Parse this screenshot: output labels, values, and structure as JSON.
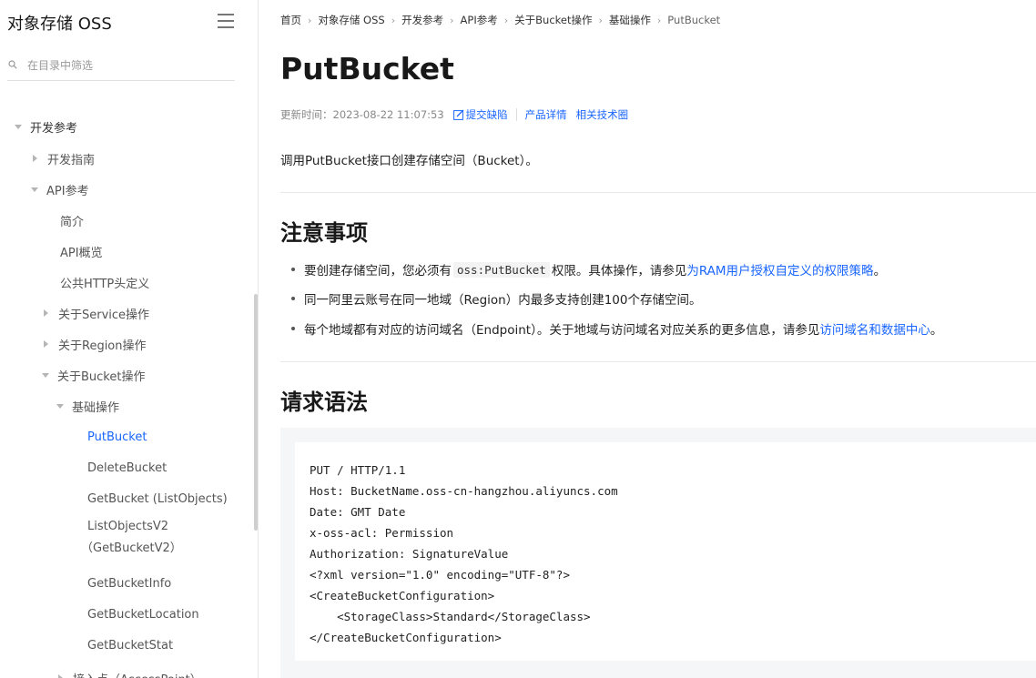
{
  "sidebar": {
    "title": "对象存储 OSS",
    "filter_placeholder": "在目录中筛选",
    "items": [
      {
        "label": "开发参考",
        "level": 1,
        "expanded": true
      },
      {
        "label": "开发指南",
        "level": 2,
        "expanded": false
      },
      {
        "label": "API参考",
        "level": 2,
        "expanded": true
      },
      {
        "label": "简介",
        "level": 3
      },
      {
        "label": "API概览",
        "level": 3
      },
      {
        "label": "公共HTTP头定义",
        "level": 3
      },
      {
        "label": "关于Service操作",
        "level": 3,
        "expanded": false
      },
      {
        "label": "关于Region操作",
        "level": 3,
        "expanded": false
      },
      {
        "label": "关于Bucket操作",
        "level": 3,
        "expanded": true
      },
      {
        "label": "基础操作",
        "level": 4,
        "expanded": true
      },
      {
        "label": "PutBucket",
        "level": 5,
        "active": true
      },
      {
        "label": "DeleteBucket",
        "level": 5
      },
      {
        "label": "GetBucket (ListObjects)",
        "level": 5
      },
      {
        "label": "ListObjectsV2",
        "level": 5
      },
      {
        "label": "（GetBucketV2）",
        "level": 5
      },
      {
        "label": "GetBucketInfo",
        "level": 5
      },
      {
        "label": "GetBucketLocation",
        "level": 5
      },
      {
        "label": "GetBucketStat",
        "level": 5
      },
      {
        "label": "接入点（AccessPoint）",
        "level": 4,
        "expanded": false
      }
    ]
  },
  "breadcrumb": [
    "首页",
    "对象存储 OSS",
    "开发参考",
    "API参考",
    "关于Bucket操作",
    "基础操作",
    "PutBucket"
  ],
  "page": {
    "title": "PutBucket",
    "updated_label": "更新时间：",
    "updated_time": "2023-08-22 11:07:53",
    "links": [
      "提交缺陷",
      "产品详情",
      "相关技术圈"
    ],
    "intro": "调用PutBucket接口创建存储空间（Bucket）。",
    "notes_heading": "注意事项",
    "notes": [
      {
        "before": "要创建存储空间，您必须有",
        "code": "oss:PutBucket",
        "middle": "权限。具体操作，请参见",
        "link": "为RAM用户授权自定义的权限策略",
        "after": "。"
      },
      {
        "before": "同一阿里云账号在同一地域（Region）内最多支持创建100个存储空间。"
      },
      {
        "before": "每个地域都有对应的访问域名（Endpoint）。关于地域与访问域名对应关系的更多信息，请参见",
        "link": "访问域名和数据中心",
        "after": "。"
      }
    ],
    "syntax_heading": "请求语法",
    "code": [
      "PUT / HTTP/1.1",
      "Host: BucketName.oss-cn-hangzhou.aliyuncs.com",
      "Date: GMT Date",
      "x-oss-acl: Permission",
      "Authorization: SignatureValue",
      "<?xml version=\"1.0\" encoding=\"UTF-8\"?>",
      "<CreateBucketConfiguration>",
      "    <StorageClass>Standard</StorageClass>",
      "</CreateBucketConfiguration>"
    ]
  },
  "colors": {
    "link": "#1a66ff",
    "text": "#181818"
  },
  "icons": {
    "menu": "hamburger-icon",
    "search": "search-icon",
    "edit": "edit-icon",
    "expand": "caret-icon"
  }
}
